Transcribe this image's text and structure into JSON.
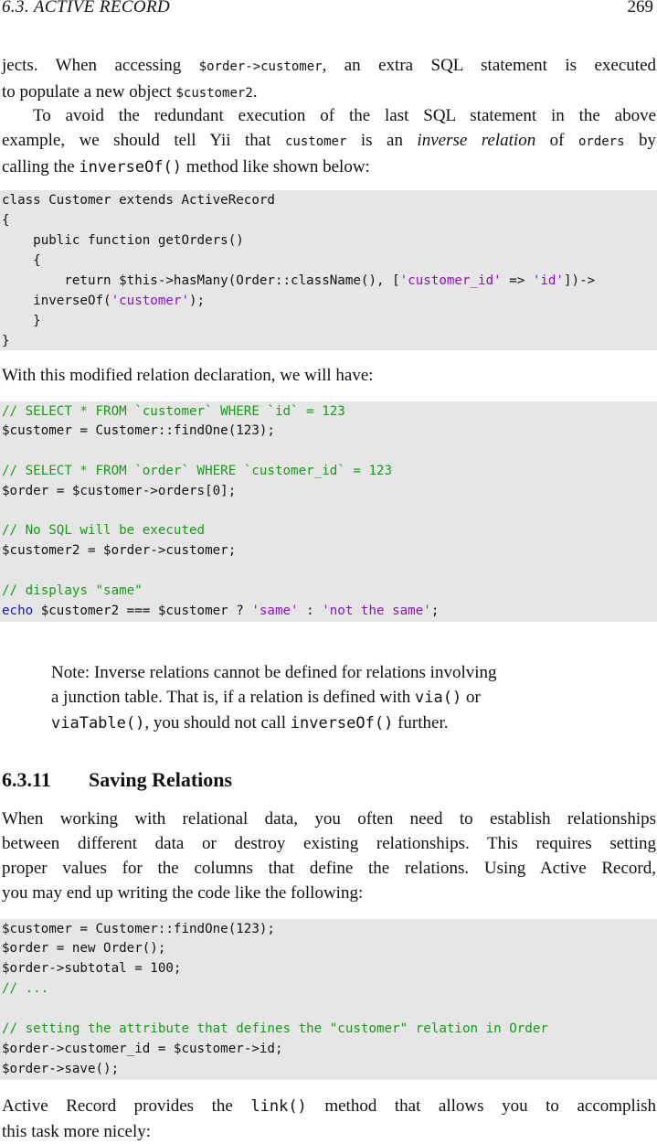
{
  "header": {
    "section": "6.3.  ACTIVE RECORD",
    "page_number": "269"
  },
  "para1": {
    "l1_a": "jects. When accessing ",
    "l1_code": "$order->customer",
    "l1_b": ", an extra SQL statement is executed",
    "l2_a": "to populate a new object ",
    "l2_code": "$customer2",
    "l2_b": "."
  },
  "para2": {
    "l1": "To avoid the redundant execution of the last SQL statement in the above",
    "l2_a": "example, we should tell Yii that ",
    "l2_code1": "customer",
    "l2_b": " is an ",
    "l2_em": "inverse relation",
    "l2_c": " of ",
    "l2_code2": "orders",
    "l2_d": " by",
    "l3_a": "calling the ",
    "l3_code": "inverseOf()",
    "l3_b": " method like shown below:"
  },
  "code1": {
    "l1": "class Customer extends ActiveRecord",
    "l2": "{",
    "l3": "    public function getOrders()",
    "l4": "    {",
    "l5_a": "        return $this->hasMany(Order::className(), [",
    "l5_s1": "'customer_id'",
    "l5_b": " => ",
    "l5_s2": "'id'",
    "l5_c": "])->",
    "l6_a": "    inverseOf(",
    "l6_s": "'customer'",
    "l6_b": ");",
    "l7": "    }",
    "l8": "}"
  },
  "para3": {
    "text": "With this modified relation declaration, we will have:"
  },
  "code2": {
    "l1": "// SELECT * FROM `customer` WHERE `id` = 123",
    "l2": "$customer = Customer::findOne(123);",
    "l3": "// SELECT * FROM `order` WHERE `customer_id` = 123",
    "l4": "$order = $customer->orders[0];",
    "l5": "// No SQL will be executed",
    "l6": "$customer2 = $order->customer;",
    "l7": "// displays \"same\"",
    "l8_kw": "echo",
    "l8_a": " $customer2 === $customer ? ",
    "l8_s1": "'same'",
    "l8_b": " : ",
    "l8_s2": "'not the same'",
    "l8_c": ";"
  },
  "note": {
    "l1": "Note: Inverse relations cannot be defined for relations involving",
    "l2_a": "a junction table.  That is, if a relation is defined with ",
    "l2_code": "via()",
    "l2_b": " or",
    "l3_code1": "viaTable()",
    "l3_a": ", you should not call ",
    "l3_code2": "inverseOf()",
    "l3_b": " further."
  },
  "section": {
    "number": "6.3.11",
    "title": "Saving Relations"
  },
  "para4": {
    "l1": "When working with relational data, you often need to establish relationships",
    "l2": "between different data or destroy existing relationships. This requires setting",
    "l3": "proper values for the columns that define the relations. Using Active Record,",
    "l4": "you may end up writing the code like the following:"
  },
  "code3": {
    "l1": "$customer = Customer::findOne(123);",
    "l2": "$order = new Order();",
    "l3": "$order->subtotal = 100;",
    "l4": "// ...",
    "l5": "// setting the attribute that defines the \"customer\" relation in Order",
    "l6": "$order->customer_id = $customer->id;",
    "l7": "$order->save();"
  },
  "para5": {
    "l1_a": "Active Record provides the ",
    "l1_code": "link()",
    "l1_b": " method that allows you to accomplish",
    "l2": "this task more nicely:"
  }
}
